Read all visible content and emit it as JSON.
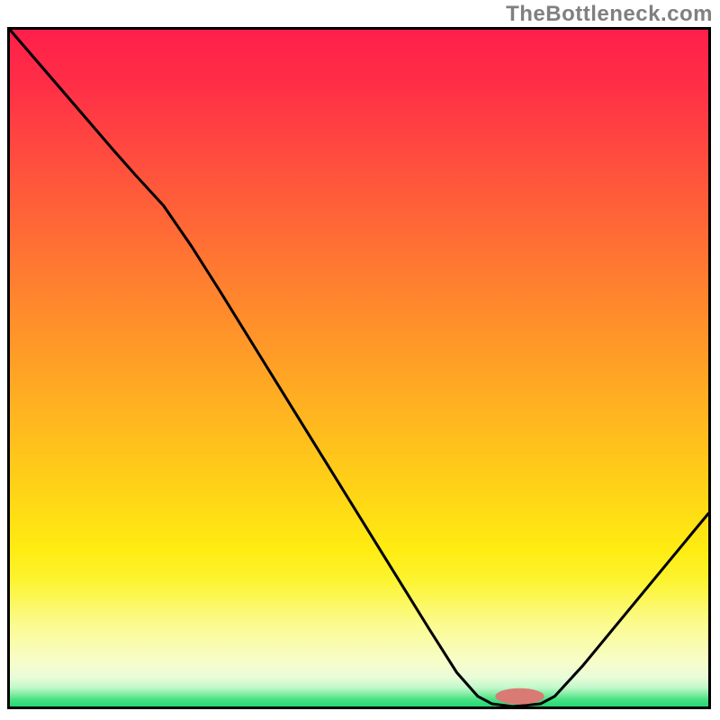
{
  "watermark": "TheBottleneck.com",
  "colors": {
    "line": "#000000",
    "marker": "#da7a75",
    "grad_stops": [
      {
        "offset": 0.0,
        "color": "#ff1f4a"
      },
      {
        "offset": 0.08,
        "color": "#ff2e47"
      },
      {
        "offset": 0.18,
        "color": "#ff4a3f"
      },
      {
        "offset": 0.28,
        "color": "#ff6537"
      },
      {
        "offset": 0.38,
        "color": "#ff812f"
      },
      {
        "offset": 0.48,
        "color": "#ff9c27"
      },
      {
        "offset": 0.58,
        "color": "#ffb81f"
      },
      {
        "offset": 0.68,
        "color": "#ffd317"
      },
      {
        "offset": 0.768,
        "color": "#ffec11"
      },
      {
        "offset": 0.815,
        "color": "#fcf432"
      },
      {
        "offset": 0.88,
        "color": "#fbfb91"
      },
      {
        "offset": 0.935,
        "color": "#f7fdca"
      },
      {
        "offset": 0.957,
        "color": "#e8fcd8"
      },
      {
        "offset": 0.972,
        "color": "#c1f8ca"
      },
      {
        "offset": 0.981,
        "color": "#87eea6"
      },
      {
        "offset": 0.989,
        "color": "#4ce286"
      },
      {
        "offset": 1.0,
        "color": "#23da71"
      }
    ]
  },
  "chart_data": {
    "type": "line",
    "title": "",
    "xlabel": "",
    "ylabel": "",
    "xlim": [
      0,
      100
    ],
    "ylim": [
      0,
      100
    ],
    "series": [
      {
        "name": "curve",
        "points": [
          {
            "x": 0.0,
            "y": 100.0
          },
          {
            "x": 5.0,
            "y": 94.0
          },
          {
            "x": 10.0,
            "y": 88.0
          },
          {
            "x": 15.0,
            "y": 82.0
          },
          {
            "x": 18.0,
            "y": 78.5
          },
          {
            "x": 22.0,
            "y": 74.0
          },
          {
            "x": 26.0,
            "y": 68.0
          },
          {
            "x": 30.0,
            "y": 61.5
          },
          {
            "x": 36.0,
            "y": 51.5
          },
          {
            "x": 42.0,
            "y": 41.5
          },
          {
            "x": 48.0,
            "y": 31.5
          },
          {
            "x": 54.0,
            "y": 21.5
          },
          {
            "x": 60.0,
            "y": 11.5
          },
          {
            "x": 64.0,
            "y": 5.0
          },
          {
            "x": 67.0,
            "y": 1.5
          },
          {
            "x": 69.0,
            "y": 0.4
          },
          {
            "x": 72.0,
            "y": 0.0
          },
          {
            "x": 76.0,
            "y": 0.4
          },
          {
            "x": 78.0,
            "y": 1.5
          },
          {
            "x": 82.0,
            "y": 6.0
          },
          {
            "x": 86.0,
            "y": 11.0
          },
          {
            "x": 90.0,
            "y": 16.0
          },
          {
            "x": 94.0,
            "y": 21.0
          },
          {
            "x": 98.0,
            "y": 26.0
          },
          {
            "x": 100.0,
            "y": 28.5
          }
        ]
      }
    ],
    "marker": {
      "x": 73.0,
      "y": 1.5,
      "rx": 3.5,
      "ry": 1.2
    }
  }
}
